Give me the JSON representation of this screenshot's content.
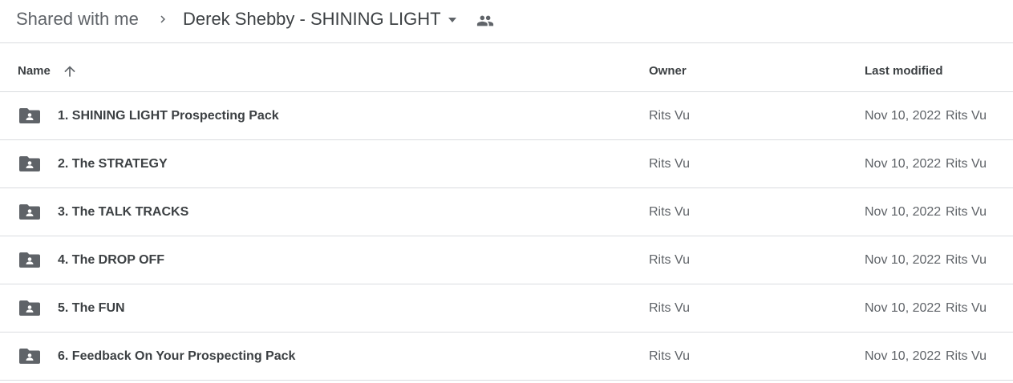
{
  "breadcrumb": {
    "root": "Shared with me",
    "current": "Derek Shebby - SHINING LIGHT"
  },
  "columns": {
    "name": "Name",
    "owner": "Owner",
    "last_modified": "Last modified",
    "sort_icon": "arrow-up-icon"
  },
  "files": [
    {
      "name": "1. SHINING LIGHT Prospecting Pack",
      "owner": "Rits Vu",
      "modified_date": "Nov 10, 2022",
      "modified_by": "Rits Vu",
      "icon": "shared-folder-icon"
    },
    {
      "name": "2. The STRATEGY",
      "owner": "Rits Vu",
      "modified_date": "Nov 10, 2022",
      "modified_by": "Rits Vu",
      "icon": "shared-folder-icon"
    },
    {
      "name": "3. The TALK TRACKS",
      "owner": "Rits Vu",
      "modified_date": "Nov 10, 2022",
      "modified_by": "Rits Vu",
      "icon": "shared-folder-icon"
    },
    {
      "name": "4. The DROP OFF",
      "owner": "Rits Vu",
      "modified_date": "Nov 10, 2022",
      "modified_by": "Rits Vu",
      "icon": "shared-folder-icon"
    },
    {
      "name": "5. The FUN",
      "owner": "Rits Vu",
      "modified_date": "Nov 10, 2022",
      "modified_by": "Rits Vu",
      "icon": "shared-folder-icon"
    },
    {
      "name": "6. Feedback On Your Prospecting Pack",
      "owner": "Rits Vu",
      "modified_date": "Nov 10, 2022",
      "modified_by": "Rits Vu",
      "icon": "shared-folder-icon"
    }
  ],
  "colors": {
    "text_primary": "#3c4043",
    "text_secondary": "#5f6368",
    "divider": "#dadce0",
    "icon": "#5f6368"
  }
}
